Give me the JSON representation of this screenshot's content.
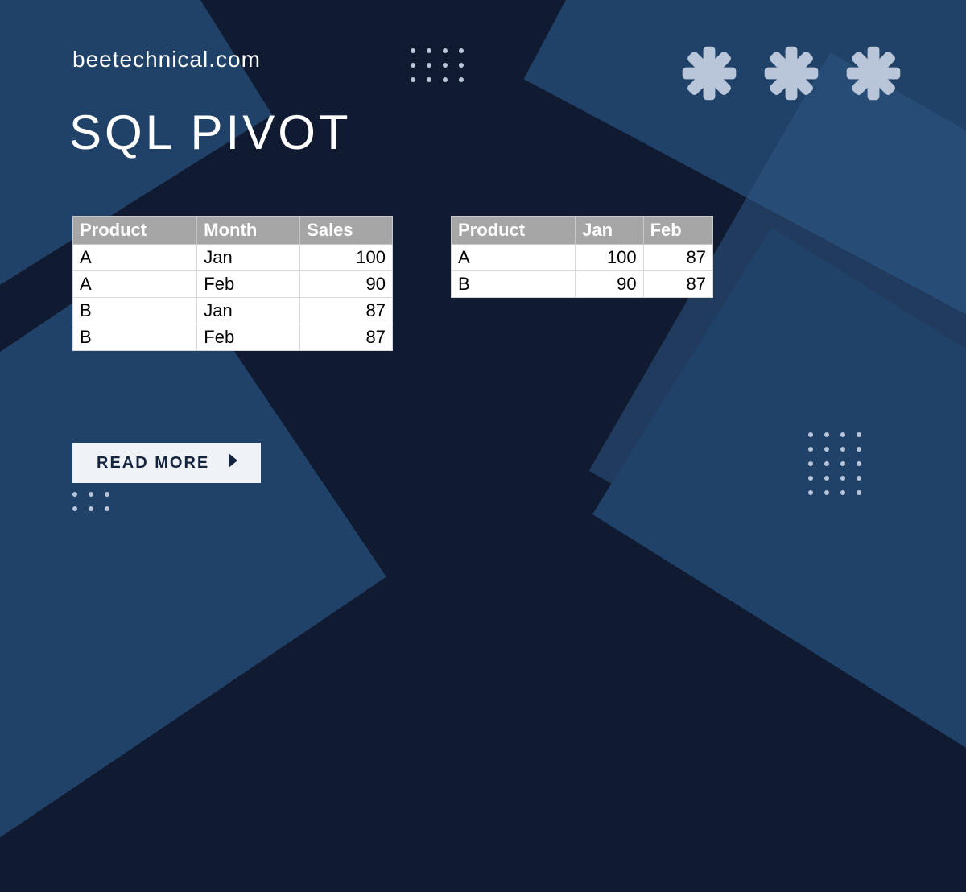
{
  "site": {
    "name": "beetechnical.com"
  },
  "heading": "SQL PIVOT",
  "cta": {
    "label": "READ MORE"
  },
  "source_table": {
    "headers": [
      "Product",
      "Month",
      "Sales"
    ],
    "rows": [
      {
        "product": "A",
        "month": "Jan",
        "sales": 100
      },
      {
        "product": "A",
        "month": "Feb",
        "sales": 90
      },
      {
        "product": "B",
        "month": "Jan",
        "sales": 87
      },
      {
        "product": "B",
        "month": "Feb",
        "sales": 87
      }
    ]
  },
  "pivot_table": {
    "headers": [
      "Product",
      "Jan",
      "Feb"
    ],
    "rows": [
      {
        "product": "A",
        "jan": 100,
        "feb": 87
      },
      {
        "product": "B",
        "jan": 90,
        "feb": 87
      }
    ]
  },
  "colors": {
    "bg_dark": "#101a30",
    "bg_blue": "#214268",
    "bg_blue_light": "#2d5884",
    "icon_light": "#b9c5d9",
    "table_header": "#a6a6a6"
  },
  "chart_data": [
    {
      "type": "table",
      "title": "Source (unpivoted) sales data",
      "columns": [
        "Product",
        "Month",
        "Sales"
      ],
      "rows": [
        [
          "A",
          "Jan",
          100
        ],
        [
          "A",
          "Feb",
          90
        ],
        [
          "B",
          "Jan",
          87
        ],
        [
          "B",
          "Feb",
          87
        ]
      ]
    },
    {
      "type": "table",
      "title": "Pivoted sales by month",
      "columns": [
        "Product",
        "Jan",
        "Feb"
      ],
      "rows": [
        [
          "A",
          100,
          87
        ],
        [
          "B",
          90,
          87
        ]
      ]
    }
  ]
}
